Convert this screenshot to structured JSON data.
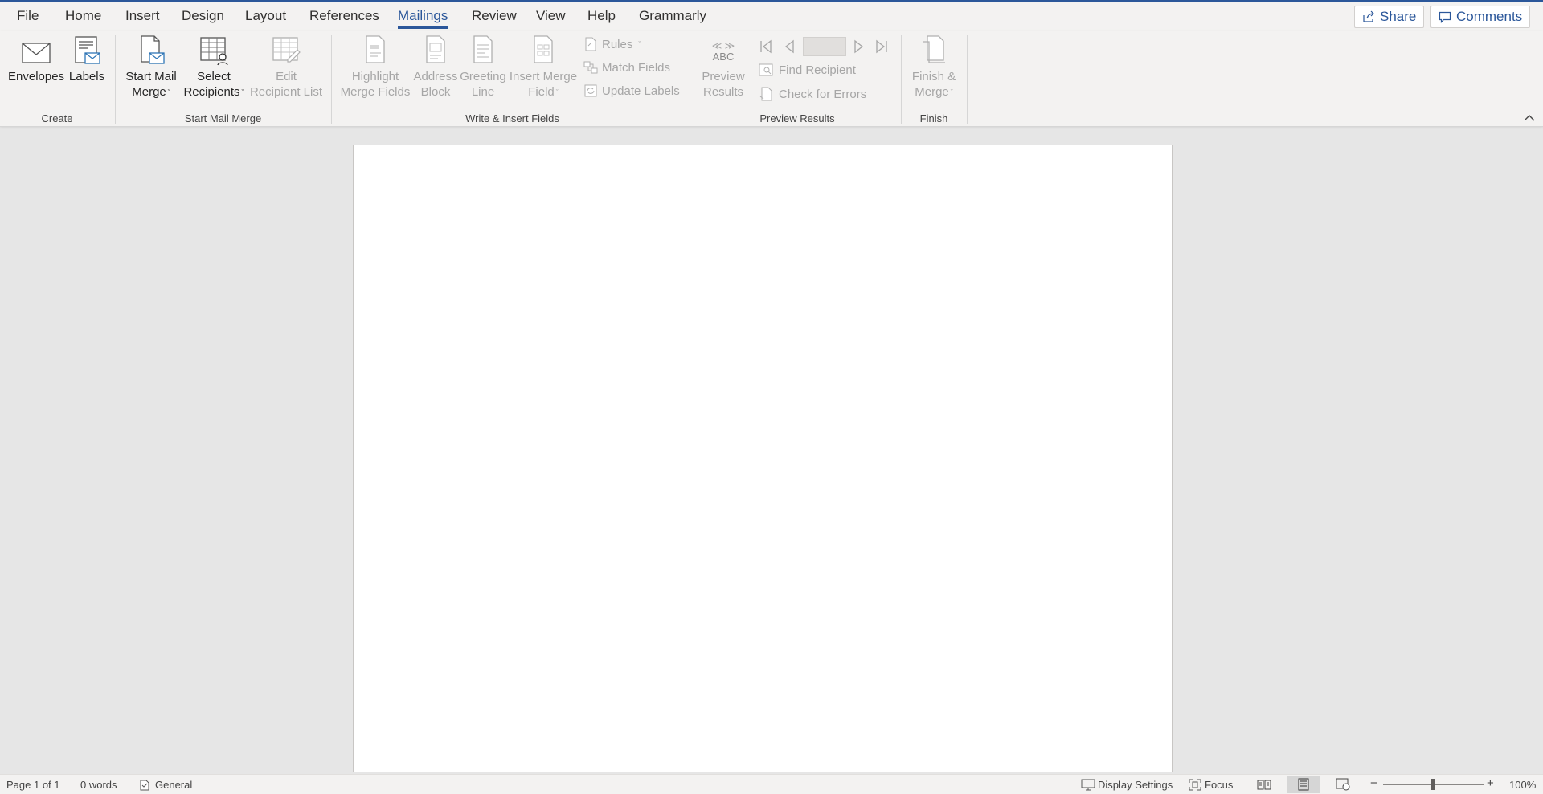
{
  "tabs": [
    {
      "label": "File"
    },
    {
      "label": "Home"
    },
    {
      "label": "Insert"
    },
    {
      "label": "Design"
    },
    {
      "label": "Layout"
    },
    {
      "label": "References"
    },
    {
      "label": "Mailings",
      "active": true
    },
    {
      "label": "Review"
    },
    {
      "label": "View"
    },
    {
      "label": "Help"
    },
    {
      "label": "Grammarly"
    }
  ],
  "share_label": "Share",
  "comments_label": "Comments",
  "groups": {
    "create": "Create",
    "start_mail_merge": "Start Mail Merge",
    "write_insert": "Write & Insert Fields",
    "preview_results": "Preview Results",
    "finish": "Finish"
  },
  "buttons": {
    "envelopes": "Envelopes",
    "labels": "Labels",
    "start_mail_merge_1": "Start Mail",
    "start_mail_merge_2": "Merge",
    "select_recipients_1": "Select",
    "select_recipients_2": "Recipients",
    "edit_list_1": "Edit",
    "edit_list_2": "Recipient List",
    "highlight_1": "Highlight",
    "highlight_2": "Merge Fields",
    "address_1": "Address",
    "address_2": "Block",
    "greeting_1": "Greeting",
    "greeting_2": "Line",
    "insert_field_1": "Insert Merge",
    "insert_field_2": "Field",
    "rules": "Rules",
    "match_fields": "Match Fields",
    "update_labels": "Update Labels",
    "preview_icon_text": "ABC",
    "preview_1": "Preview",
    "preview_2": "Results",
    "find_recipient": "Find Recipient",
    "check_errors": "Check for Errors",
    "finish_1": "Finish &",
    "finish_2": "Merge"
  },
  "status": {
    "page": "Page 1 of 1",
    "words": "0 words",
    "language": "General",
    "display_settings": "Display Settings",
    "focus": "Focus",
    "zoom": "100%"
  },
  "colors": {
    "accent": "#2b579a",
    "disabled": "#a6a6a6",
    "ribbon_bg": "#f3f2f1",
    "canvas_bg": "#e6e6e6"
  }
}
